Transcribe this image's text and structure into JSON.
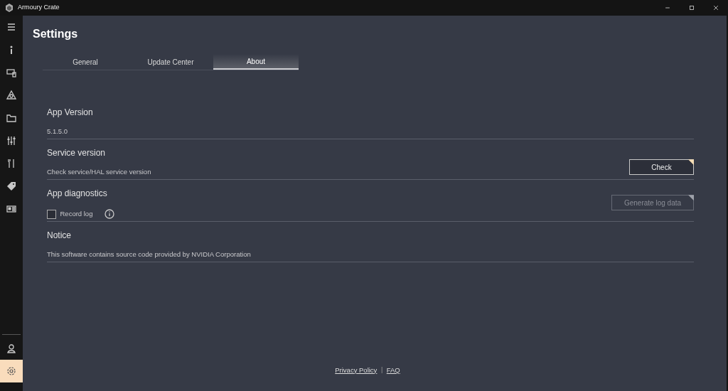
{
  "window": {
    "title": "Armoury Crate"
  },
  "sidebar": {
    "items": [
      {
        "kind": "menu",
        "selected": false
      },
      {
        "kind": "device",
        "selected": false
      },
      {
        "kind": "keyboard",
        "selected": false
      },
      {
        "kind": "aura",
        "selected": false
      },
      {
        "kind": "folder",
        "selected": false
      },
      {
        "kind": "sliders",
        "selected": false
      },
      {
        "kind": "tools",
        "selected": false
      },
      {
        "kind": "tag",
        "selected": false
      },
      {
        "kind": "news",
        "selected": false
      }
    ],
    "bottom_items": [
      {
        "kind": "user",
        "selected": false
      },
      {
        "kind": "settings",
        "selected": true
      }
    ]
  },
  "page": {
    "title": "Settings"
  },
  "tabs": [
    {
      "label": "General",
      "selected": false
    },
    {
      "label": "Update Center",
      "selected": false
    },
    {
      "label": "About",
      "selected": true
    }
  ],
  "sections": [
    {
      "kind": "text",
      "title": "App Version",
      "text": "5.1.5.0"
    },
    {
      "kind": "button",
      "title": "Service version",
      "text": "Check service/HAL service version",
      "button": {
        "label": "Check",
        "disabled": false
      }
    },
    {
      "kind": "checkbox",
      "title": "App diagnostics",
      "checkbox": {
        "label": "Record log",
        "checked": false
      },
      "button": {
        "label": "Generate log data",
        "disabled": true
      }
    },
    {
      "kind": "text",
      "title": "Notice",
      "text": "This software contains source code provided by NVIDIA Corporation"
    }
  ],
  "footer": {
    "links": [
      "Privacy Policy",
      "FAQ"
    ],
    "separator": "|"
  }
}
